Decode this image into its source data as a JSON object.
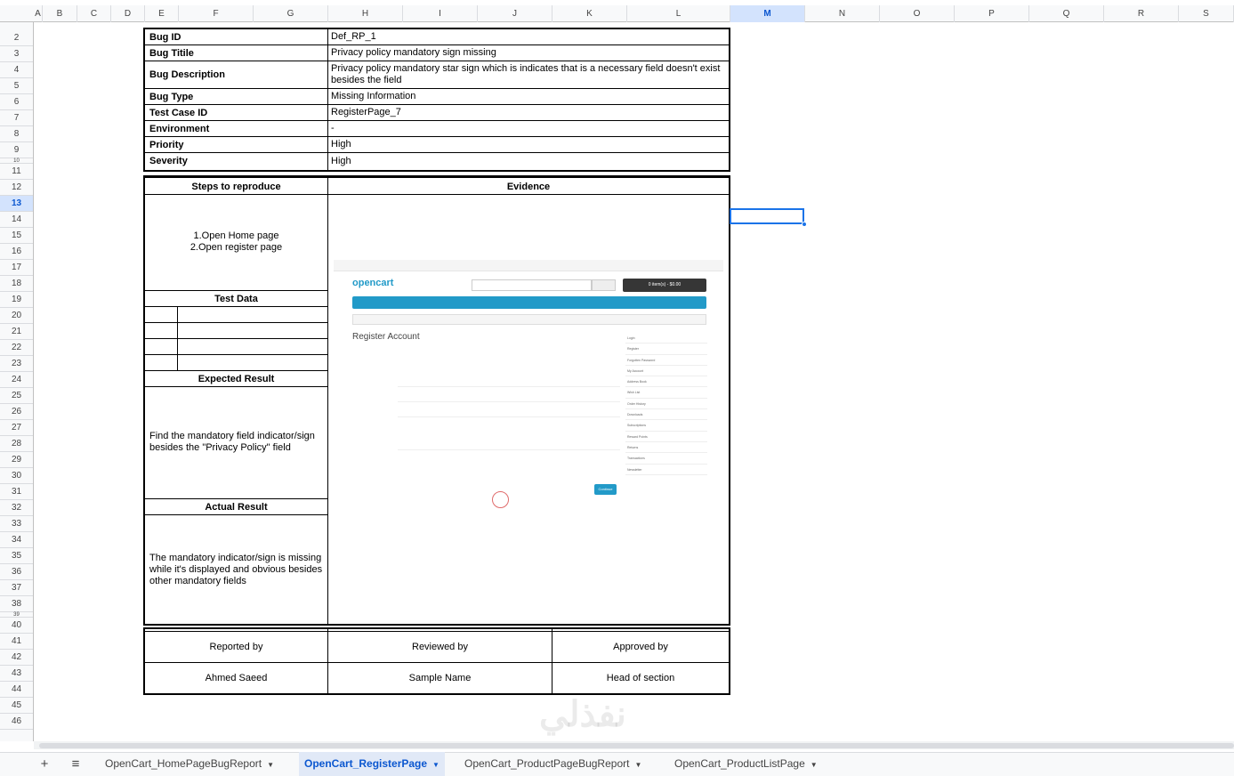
{
  "columns": [
    "A",
    "B",
    "C",
    "D",
    "E",
    "F",
    "G",
    "H",
    "I",
    "J",
    "K",
    "L",
    "M",
    "N",
    "O",
    "P",
    "Q",
    "R",
    "S"
  ],
  "active_column": "M",
  "rows": [
    "2",
    "3",
    "4",
    "5",
    "6",
    "7",
    "8",
    "9",
    "10",
    "11",
    "12",
    "13",
    "14",
    "15",
    "16",
    "17",
    "18",
    "19",
    "20",
    "21",
    "22",
    "23",
    "24",
    "25",
    "26",
    "27",
    "28",
    "29",
    "30",
    "31",
    "32",
    "33",
    "34",
    "35",
    "36",
    "37",
    "38",
    "39",
    "40",
    "41",
    "42",
    "43",
    "44",
    "45",
    "46"
  ],
  "active_row": "13",
  "bug_info": {
    "labels": {
      "bug_id": "Bug ID",
      "bug_title": "Bug Titile",
      "bug_description": "Bug Description",
      "bug_type": "Bug Type",
      "test_case_id": "Test Case ID",
      "environment": "Environment",
      "priority": "Priority",
      "severity": "Severity"
    },
    "values": {
      "bug_id": "Def_RP_1",
      "bug_title": "Privacy policy mandatory sign missing",
      "bug_description": "Privacy policy mandatory star sign which is indicates that is a necessary field doesn't exist besides the field",
      "bug_type": "Missing Information",
      "test_case_id": "RegisterPage_7",
      "environment": "-",
      "priority": "High",
      "severity": "High"
    }
  },
  "details": {
    "steps_header": "Steps to reproduce",
    "evidence_header": "Evidence",
    "steps_line1": "1.Open Home page",
    "steps_line2": "2.Open register page",
    "test_data_header": "Test Data",
    "expected_header": "Expected Result",
    "expected_text": "Find the mandatory field indicator/sign besides the \"Privacy Policy\" field",
    "actual_header": "Actual Result",
    "actual_text": "The mandatory indicator/sign is missing while it's displayed and obvious besides other mandatory fields"
  },
  "evidence": {
    "logo": "opencart",
    "cart": "0 item(s) - $0.00",
    "heading": "Register Account",
    "continue": "Continue",
    "sidebar": [
      "Login",
      "Register",
      "Forgotten Password",
      "My Account",
      "Address Book",
      "Wish List",
      "Order History",
      "Downloads",
      "Subscriptions",
      "Reward Points",
      "Returns",
      "Transactions",
      "Newsletter"
    ]
  },
  "signoff": {
    "reported_by_label": "Reported by",
    "reviewed_by_label": "Reviewed by",
    "approved_by_label": "Approved by",
    "reported_by": "Ahmed Saeed",
    "reviewed_by": "Sample Name",
    "approved_by": "Head of section"
  },
  "sheet_tabs": [
    "OpenCart_HomePageBugReport",
    "OpenCart_RegisterPage",
    "OpenCart_ProductPageBugReport",
    "OpenCart_ProductListPage"
  ],
  "active_tab": "OpenCart_RegisterPage",
  "watermark": "نفذلي"
}
